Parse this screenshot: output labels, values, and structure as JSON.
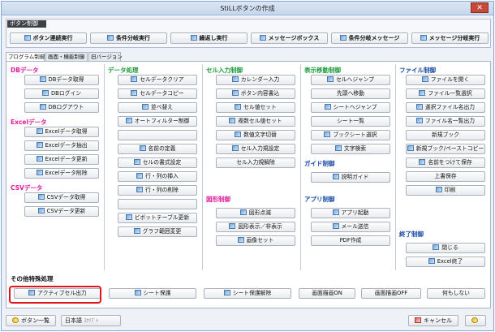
{
  "window": {
    "title": "StiLLボタンの作成",
    "close_glyph": "✕"
  },
  "macro": {
    "header": "ボタン制御",
    "buttons": [
      "ボタン連続実行",
      "条件分岐実行",
      "繰返し実行",
      "メッセージボックス",
      "条件分岐メッセージ",
      "メッセージ分岐実行"
    ]
  },
  "tabs": [
    "プログラム制御",
    "画面・機能制御",
    "旧バージョン"
  ],
  "sections": {
    "db": {
      "title": "DBデータ",
      "buttons": [
        "DBデータ取得",
        "DBログイン",
        "DBログアウト"
      ]
    },
    "excel": {
      "title": "Excelデータ",
      "buttons": [
        "Excelデータ取得",
        "Excelデータ抽出",
        "Excelデータ更新",
        "Excelデータ削除"
      ]
    },
    "csv": {
      "title": "CSVデータ",
      "buttons": [
        "CSVデータ取得",
        "CSVデータ更新"
      ]
    },
    "data": {
      "title": "データ処理",
      "buttons": [
        "セルデータクリア",
        "セルデータコピー",
        "並べ替え",
        "オートフィルター制御",
        "",
        "名前の定義",
        "セルの書式設定",
        "行・列の挿入",
        "行・列の削除",
        "",
        "ピボットテーブル更新",
        "グラフ範囲変更"
      ]
    },
    "cellinput": {
      "title": "セル入力制御",
      "buttons": [
        "カレンダー入力",
        "ボタン内容書込",
        "セル値セット",
        "複数セル値セット",
        "数値文字切替",
        "セル入力規設定",
        "セル入力規解除"
      ]
    },
    "shape": {
      "title": "図形制御",
      "buttons": [
        "図形点滅",
        "図形表示／非表示",
        "画像セット"
      ]
    },
    "display": {
      "title": "表示移動制御",
      "buttons": [
        "セルへジャンプ",
        "先頭へ移動",
        "シートへジャンプ",
        "シート一覧",
        "ブックシート選択",
        "文字検索"
      ]
    },
    "guide": {
      "title": "ガイド制御",
      "buttons": [
        "説明ガイド"
      ]
    },
    "app": {
      "title": "アプリ制御",
      "buttons": [
        "アプリ起動",
        "メール送信",
        "PDF作成"
      ]
    },
    "file": {
      "title": "ファイル制御",
      "buttons": [
        "ファイルを開く",
        "ファイル一覧選択",
        "選択ファイル名出力",
        "ファイル名一覧出力",
        "新規ブック",
        "新規ブック/ペーストコピー",
        "名前をつけて保存",
        "上書保存",
        "印刷"
      ]
    },
    "end": {
      "title": "終了制御",
      "buttons": [
        "閉じる",
        "Excel終了"
      ]
    },
    "other": {
      "title": "その他特殊処理",
      "buttons": [
        "アクティブセル出力",
        "シート保護",
        "シート保護解除",
        "画面描画ON",
        "画面描画OFF",
        "何もしない"
      ]
    }
  },
  "footer": {
    "list_button": "ボタン一覧",
    "lang_button": "日本語",
    "lang_sub": "ｽｸﾘﾌﾟﾄ",
    "cancel_button": "キャンセル",
    "help_glyph": "?"
  },
  "colors": {
    "accent_red": "#e0141c",
    "section_pink": "#e01c9c",
    "section_green": "#1a9a3a",
    "section_blue": "#1a4aa8"
  }
}
